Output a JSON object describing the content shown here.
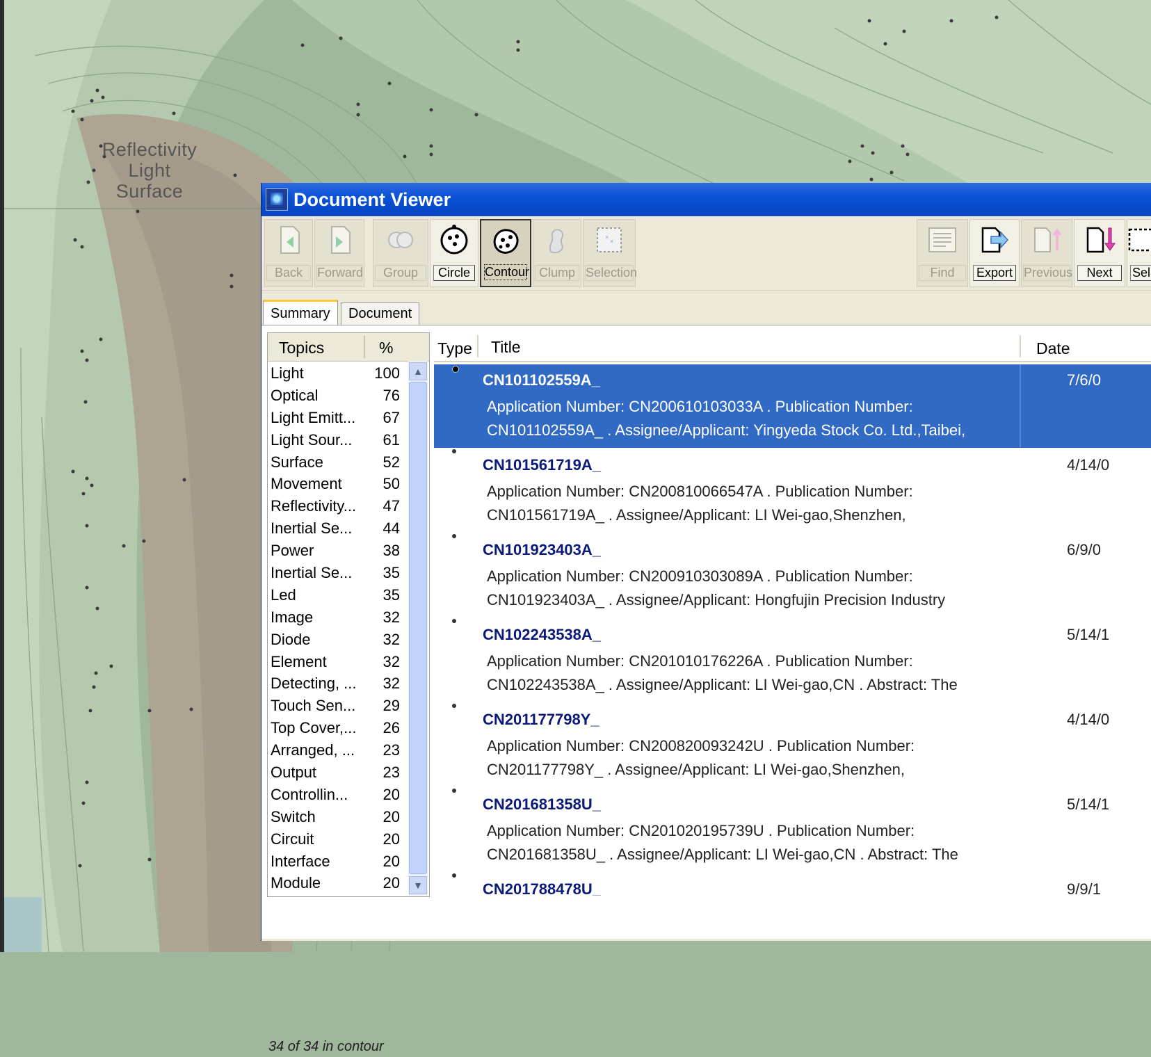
{
  "map": {
    "cluster_label": [
      "Reflectivity",
      "Light",
      "Surface"
    ],
    "colors": {
      "land_dark": "#a69b8b",
      "green_light": "#b7cdb1",
      "green_mid": "#9fb79b",
      "water": "#a9c7c9"
    }
  },
  "window": {
    "title": "Document Viewer",
    "accent": "#0a52d6"
  },
  "toolbar": {
    "buttons": [
      {
        "label": "Back",
        "icon": "back-arrow-icon",
        "state": "disabled"
      },
      {
        "label": "Forward",
        "icon": "forward-arrow-icon",
        "state": "disabled"
      },
      {
        "label": "Group",
        "icon": "group-circles-icon",
        "state": "disabled"
      },
      {
        "label": "Circle",
        "icon": "circle-select-icon",
        "state": "enabled"
      },
      {
        "label": "Contour",
        "icon": "contour-select-icon",
        "state": "pressed"
      },
      {
        "label": "Clump",
        "icon": "clump-icon",
        "state": "disabled"
      },
      {
        "label": "Selection",
        "icon": "selection-box-icon",
        "state": "disabled"
      },
      {
        "label": "Find",
        "icon": "find-document-icon",
        "state": "disabled"
      },
      {
        "label": "Export",
        "icon": "export-document-icon",
        "state": "enabled"
      },
      {
        "label": "Previous",
        "icon": "previous-document-icon",
        "state": "disabled"
      },
      {
        "label": "Next",
        "icon": "next-document-icon",
        "state": "enabled"
      },
      {
        "label": "Sel",
        "icon": "select-icon",
        "state": "enabled"
      }
    ]
  },
  "tabs": {
    "summary": "Summary",
    "document": "Document"
  },
  "topics": {
    "header_topic": "Topics",
    "header_pct": "%",
    "items": [
      {
        "name": "Light",
        "pct": "100"
      },
      {
        "name": "Optical",
        "pct": "76"
      },
      {
        "name": "Light Emitt...",
        "pct": "67"
      },
      {
        "name": "Light Sour...",
        "pct": "61"
      },
      {
        "name": "Surface",
        "pct": "52"
      },
      {
        "name": "Movement",
        "pct": "50"
      },
      {
        "name": "Reflectivity...",
        "pct": "47"
      },
      {
        "name": "Inertial Se...",
        "pct": "44"
      },
      {
        "name": "Power",
        "pct": "38"
      },
      {
        "name": "Inertial Se...",
        "pct": "35"
      },
      {
        "name": "Led",
        "pct": "35"
      },
      {
        "name": "Image",
        "pct": "32"
      },
      {
        "name": "Diode",
        "pct": "32"
      },
      {
        "name": "Element",
        "pct": "32"
      },
      {
        "name": "Detecting, ...",
        "pct": "32"
      },
      {
        "name": "Touch Sen...",
        "pct": "29"
      },
      {
        "name": "Top Cover,...",
        "pct": "26"
      },
      {
        "name": "Arranged, ...",
        "pct": "23"
      },
      {
        "name": "Output",
        "pct": "23"
      },
      {
        "name": "Controllin...",
        "pct": "20"
      },
      {
        "name": "Switch",
        "pct": "20"
      },
      {
        "name": "Circuit",
        "pct": "20"
      },
      {
        "name": "Interface",
        "pct": "20"
      },
      {
        "name": "Module",
        "pct": "20"
      }
    ]
  },
  "results": {
    "header_type": "Type",
    "header_title": "Title",
    "header_date": "Date",
    "rows": [
      {
        "title": "CN101102559A_",
        "date": "7/6/0",
        "line1": "Application Number: CN200610103033A . Publication Number:",
        "line2": "CN101102559A_ . Assignee/Applicant: Yingyeda Stock Co. Ltd.,Taibei,",
        "selected": true
      },
      {
        "title": "CN101561719A_",
        "date": "4/14/0",
        "line1": "Application Number: CN200810066547A . Publication Number:",
        "line2": "CN101561719A_ . Assignee/Applicant: LI Wei-gao,Shenzhen,",
        "selected": false
      },
      {
        "title": "CN101923403A_",
        "date": "6/9/0",
        "line1": "Application Number: CN200910303089A . Publication Number:",
        "line2": "CN101923403A_ . Assignee/Applicant: Hongfujin Precision Industry",
        "selected": false
      },
      {
        "title": "CN102243538A_",
        "date": "5/14/1",
        "line1": "Application Number: CN201010176226A . Publication Number:",
        "line2": "CN102243538A_ . Assignee/Applicant: LI Wei-gao,CN . Abstract: The",
        "selected": false
      },
      {
        "title": "CN201177798Y_",
        "date": "4/14/0",
        "line1": "Application Number: CN200820093242U . Publication Number:",
        "line2": "CN201177798Y_ . Assignee/Applicant: LI Wei-gao,Shenzhen,",
        "selected": false
      },
      {
        "title": "CN201681358U_",
        "date": "5/14/1",
        "line1": "Application Number: CN201020195739U . Publication Number:",
        "line2": "CN201681358U_ . Assignee/Applicant: LI Wei-gao,CN . Abstract: The",
        "selected": false
      },
      {
        "title": "CN201788478U_",
        "date": "9/9/1",
        "line1": "",
        "line2": "",
        "selected": false
      }
    ]
  },
  "status": {
    "text": "34 of 34 in contour"
  }
}
